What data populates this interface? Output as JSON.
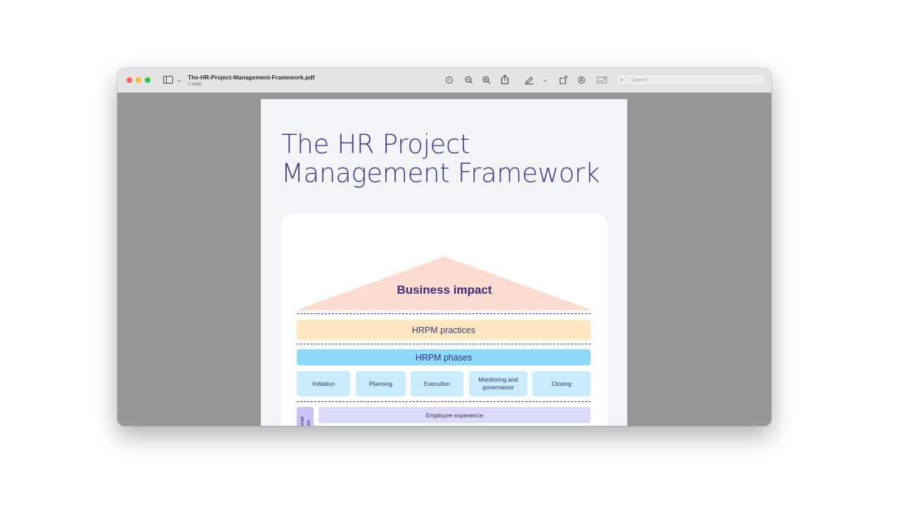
{
  "window": {
    "title": "The-HR-Project-Management-Framework.pdf",
    "subtitle": "1 page",
    "toolbar_icons": [
      "sidebar-icon",
      "chevron-down-icon",
      "info-icon",
      "zoom-out-icon",
      "zoom-in-icon",
      "share-icon",
      "markup-pen-icon",
      "chevron-down-icon",
      "rotate-icon",
      "annotate-icon",
      "form-fill-icon"
    ],
    "search": {
      "placeholder": "Search",
      "value": ""
    }
  },
  "document": {
    "title_line1": "The HR Project",
    "title_line2": "Management Framework",
    "roof_label": "Business impact",
    "practices_label": "HRPM practices",
    "phases_label": "HRPM phases",
    "phases": [
      "Initiation",
      "Planning",
      "Execution",
      "Monitoring and governance",
      "Closing"
    ],
    "side_tab_label": "tered\nes",
    "experience_label": "Employee experience",
    "colors": {
      "title": "#3f3a87",
      "roof": "#fcdcd0",
      "practices": "#ffe8c2",
      "phases": "#8fdafa",
      "phase_box": "#c8ecfb",
      "experience": "#dcdafb"
    }
  }
}
